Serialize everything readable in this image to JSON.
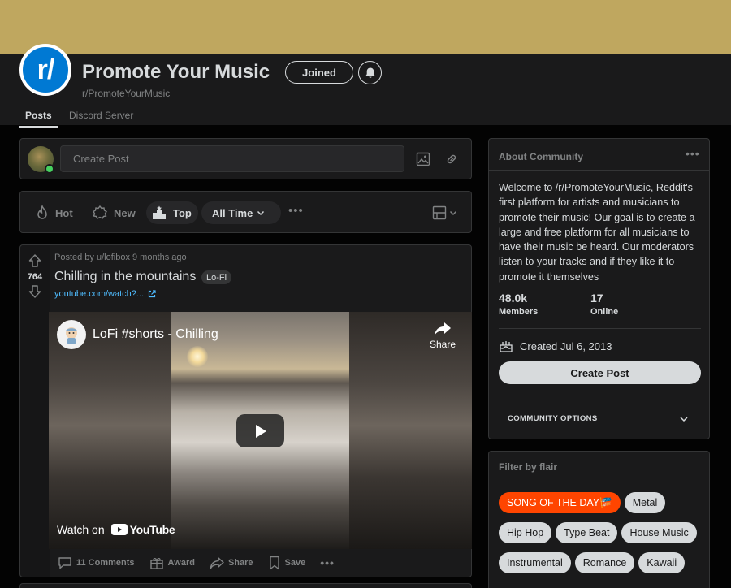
{
  "subreddit": {
    "title": "Promote Your Music",
    "name": "r/PromoteYourMusic",
    "icon_text": "r/",
    "joined_label": "Joined"
  },
  "tabs": [
    {
      "label": "Posts",
      "active": true
    },
    {
      "label": "Discord Server",
      "active": false
    }
  ],
  "create_post": {
    "placeholder": "Create Post"
  },
  "sort": {
    "hot": "Hot",
    "new": "New",
    "top": "Top",
    "time_range": "All Time"
  },
  "post": {
    "votes": "764",
    "meta": "Posted by u/lofibox 9 months ago",
    "title": "Chilling in the mountains",
    "flair": "Lo-Fi",
    "link": "youtube.com/watch?...",
    "video": {
      "title": "LoFi #shorts - Chilling",
      "share_label": "Share",
      "watch_on": "Watch on",
      "youtube": "YouTube"
    },
    "actions": {
      "comments": "11 Comments",
      "award": "Award",
      "share": "Share",
      "save": "Save"
    }
  },
  "about": {
    "heading": "About Community",
    "description": "Welcome to /r/PromoteYourMusic, Reddit's first platform for artists and musicians to promote their music! Our goal is to create a large and free platform for all musicians to have their music be heard. Our moderators listen to your tracks and if they like it to promote it themselves",
    "members_value": "48.0k",
    "members_label": "Members",
    "online_value": "17",
    "online_label": "Online",
    "created": "Created Jul 6, 2013",
    "create_post_button": "Create Post",
    "community_options": "COMMUNITY OPTIONS"
  },
  "flair_filter": {
    "heading": "Filter by flair",
    "tags": [
      "SONG OF THE DAY🎏",
      "Metal",
      "Hip Hop",
      "Type Beat",
      "House Music",
      "Instrumental",
      "Romance",
      "Kawaii"
    ]
  },
  "colors": {
    "accent_orange": "#ff4500",
    "banner": "#bfa75f",
    "subreddit_icon": "#0079d3",
    "link_blue": "#4fbcff",
    "online_green": "#46d160"
  }
}
